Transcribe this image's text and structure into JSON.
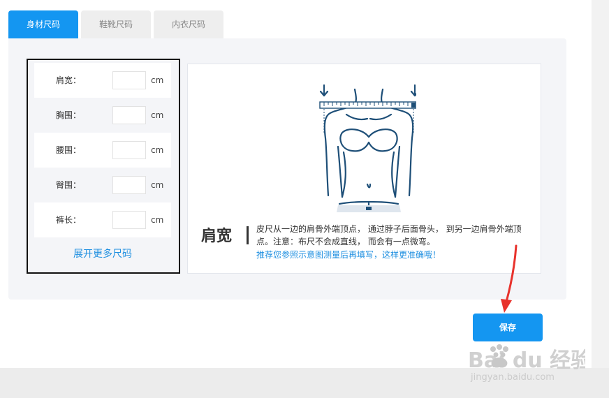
{
  "tabs": [
    {
      "label": "身材尺码",
      "active": true
    },
    {
      "label": "鞋靴尺码",
      "active": false
    },
    {
      "label": "内衣尺码",
      "active": false
    }
  ],
  "form": {
    "fields": [
      {
        "label": "肩宽：",
        "value": "",
        "unit": "cm"
      },
      {
        "label": "胸围：",
        "value": "",
        "unit": "cm"
      },
      {
        "label": "腰围：",
        "value": "",
        "unit": "cm"
      },
      {
        "label": "臀围：",
        "value": "",
        "unit": "cm"
      },
      {
        "label": "裤长：",
        "value": "",
        "unit": "cm"
      }
    ],
    "expand_label": "展开更多尺码"
  },
  "illustration": {
    "name": "肩宽",
    "description": "皮尺从一边的肩骨外端顶点， 通过脖子后面骨头， 到另一边肩骨外端顶点。注意：布尺不会成直线， 而会有一点微弯。",
    "tip": "推荐您参照示意图测量后再填写，这样更准确哦！"
  },
  "save_label": "保存",
  "watermark": {
    "brand": "Bai du 经验",
    "url": "jingyan.baidu.com"
  },
  "colors": {
    "accent": "#1496f1",
    "link": "#1e8fe0",
    "annotation": "#e8322c",
    "illustration_stroke": "#1e4f78"
  }
}
